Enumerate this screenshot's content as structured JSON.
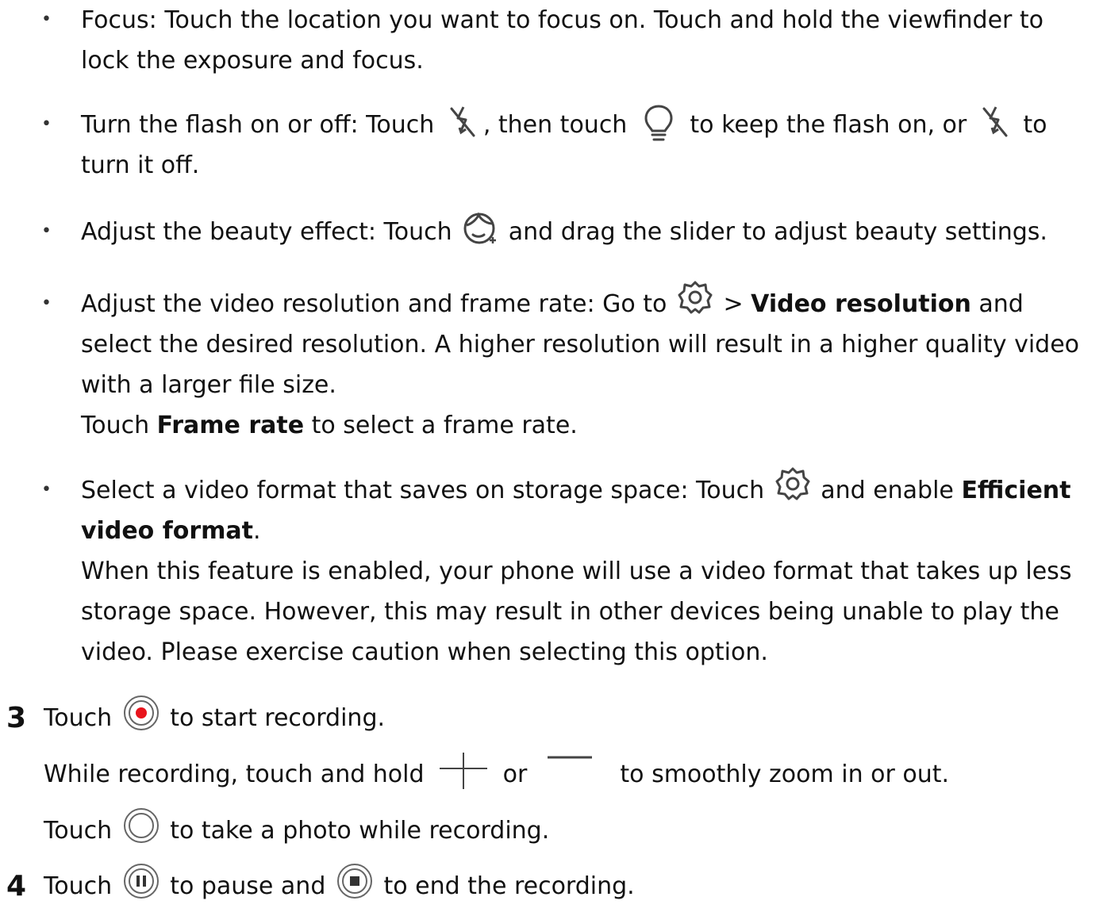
{
  "bullets": [
    {
      "lead": "Focus: Touch the location you want to focus on. Touch and hold the viewfinder to lock the exposure and focus."
    },
    {
      "t1": "Turn the flash on or off: Touch",
      "t2": ", then touch",
      "t3": "to keep the flash on, or",
      "t4": "to",
      "t5": "turn it off."
    },
    {
      "t1": "Adjust the beauty effect: Touch",
      "t2": "and drag the slider to adjust beauty settings."
    },
    {
      "t1": "Adjust the video resolution and frame rate: Go to",
      "t2": ">",
      "bold1": "Video resolution",
      "t3": "and select the desired resolution. A higher resolution will result in a higher quality video with a larger file size.",
      "t4": "Touch",
      "bold2": "Frame rate",
      "t5": "to select a frame rate."
    },
    {
      "t1": "Select a video format that saves on storage space: Touch",
      "t2": "and enable",
      "bold1": "Efficient video format",
      "t3": ".",
      "t4": "When this feature is enabled, your phone will use a video format that takes up less storage space. However, this may result in other devices being unable to play the video. Please exercise caution when selecting this option."
    }
  ],
  "steps": [
    {
      "number": "3",
      "line1_a": "Touch",
      "line1_b": "to start recording.",
      "line2_a": "While recording, touch and hold",
      "line2_b": "or",
      "line2_c": "to smoothly zoom in or out.",
      "line3_a": "Touch",
      "line3_b": "to take a photo while recording."
    },
    {
      "number": "4",
      "line1_a": "Touch",
      "line1_b": "to pause and",
      "line1_c": "to end the recording."
    }
  ],
  "icons": {
    "flash_off": "flash-off-icon",
    "flash_on": "bulb-icon",
    "beauty": "beauty-face-icon",
    "settings": "gear-icon",
    "record": "record-button-icon",
    "zoom_in": "plus-icon",
    "zoom_out": "minus-icon",
    "snapshot": "shutter-icon",
    "pause": "pause-icon",
    "stop": "stop-icon",
    "record_color": "#e8141c"
  }
}
